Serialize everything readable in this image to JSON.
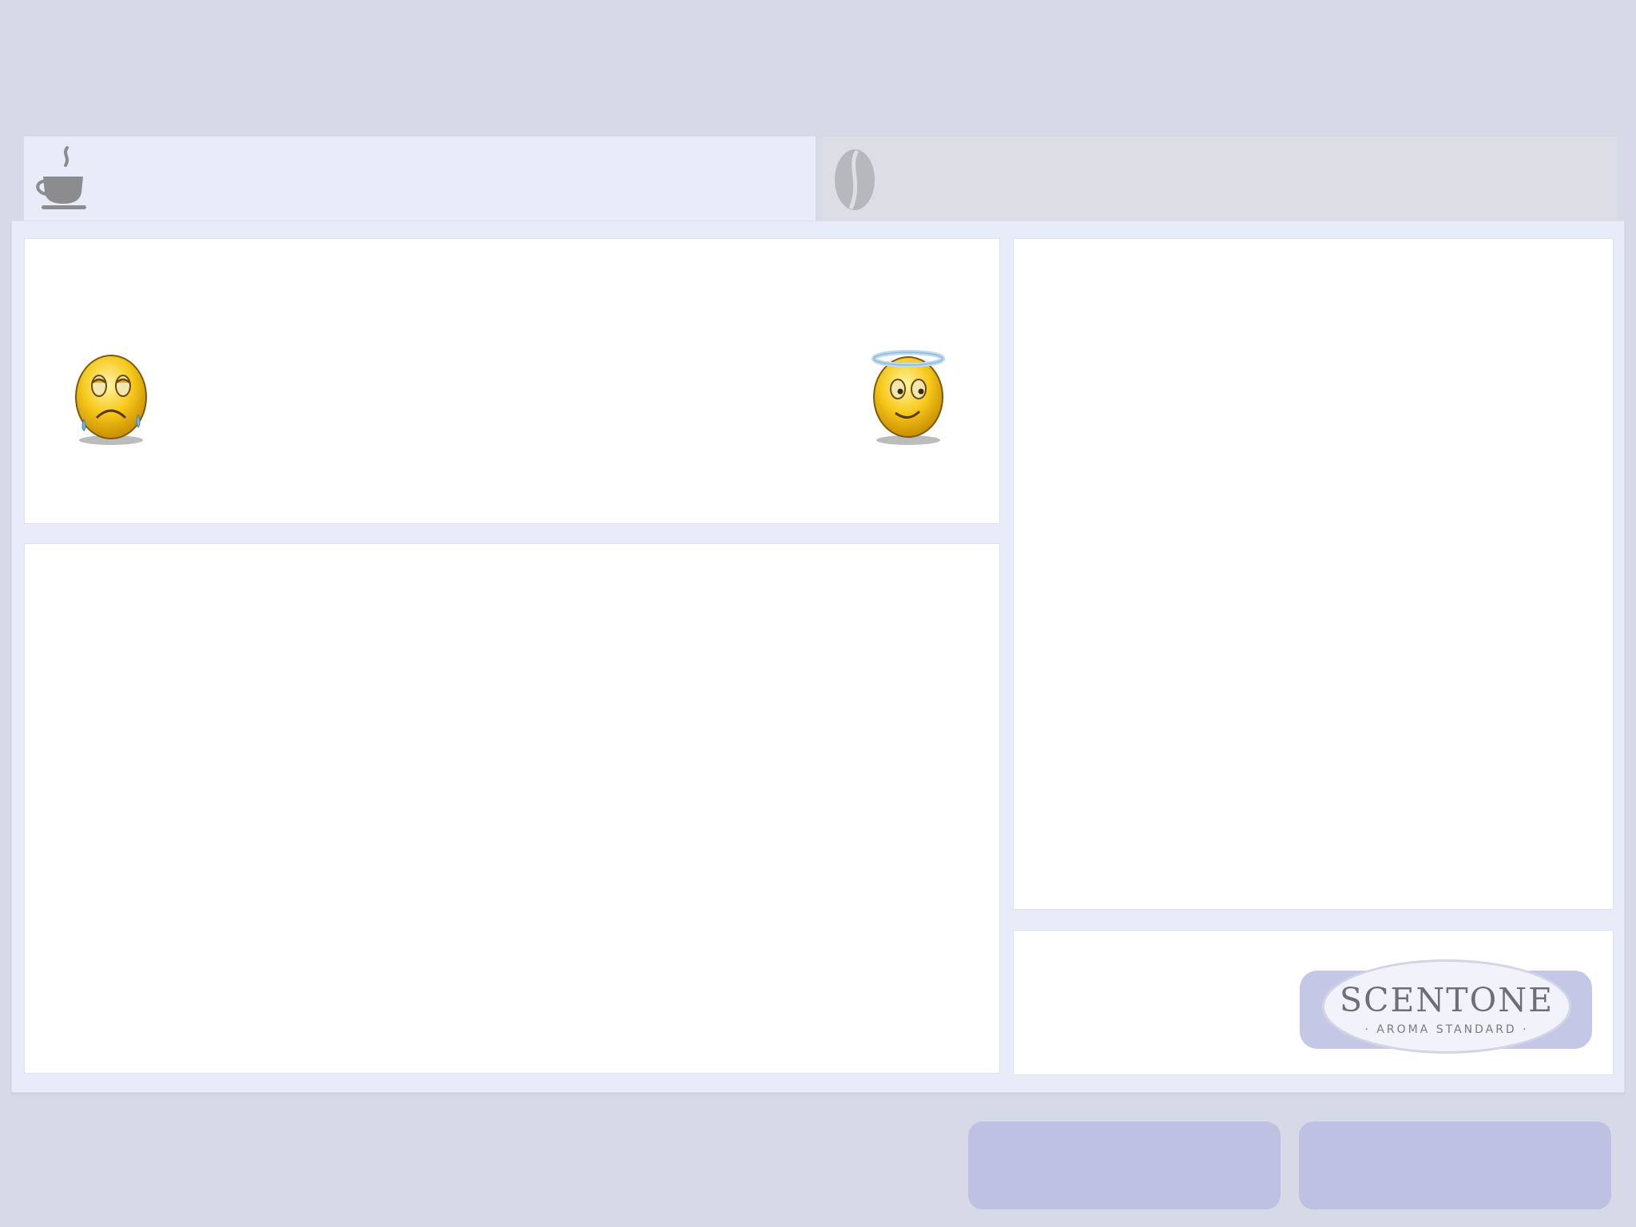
{
  "tabs": [
    {
      "icon": "coffee-cup-icon",
      "selected": true
    },
    {
      "icon": "coffee-bean-icon",
      "selected": false
    }
  ],
  "rating_scale": {
    "low_icon": "crying-face-icon",
    "high_icon": "angel-face-icon"
  },
  "brand": {
    "name": "SCENTONE",
    "tagline": "· AROMA STANDARD ·"
  },
  "colors": {
    "background": "#d6d9e6",
    "panel": "#e8ebf8",
    "button": "#bec1e1",
    "inactive_tab": "#dddee5"
  }
}
